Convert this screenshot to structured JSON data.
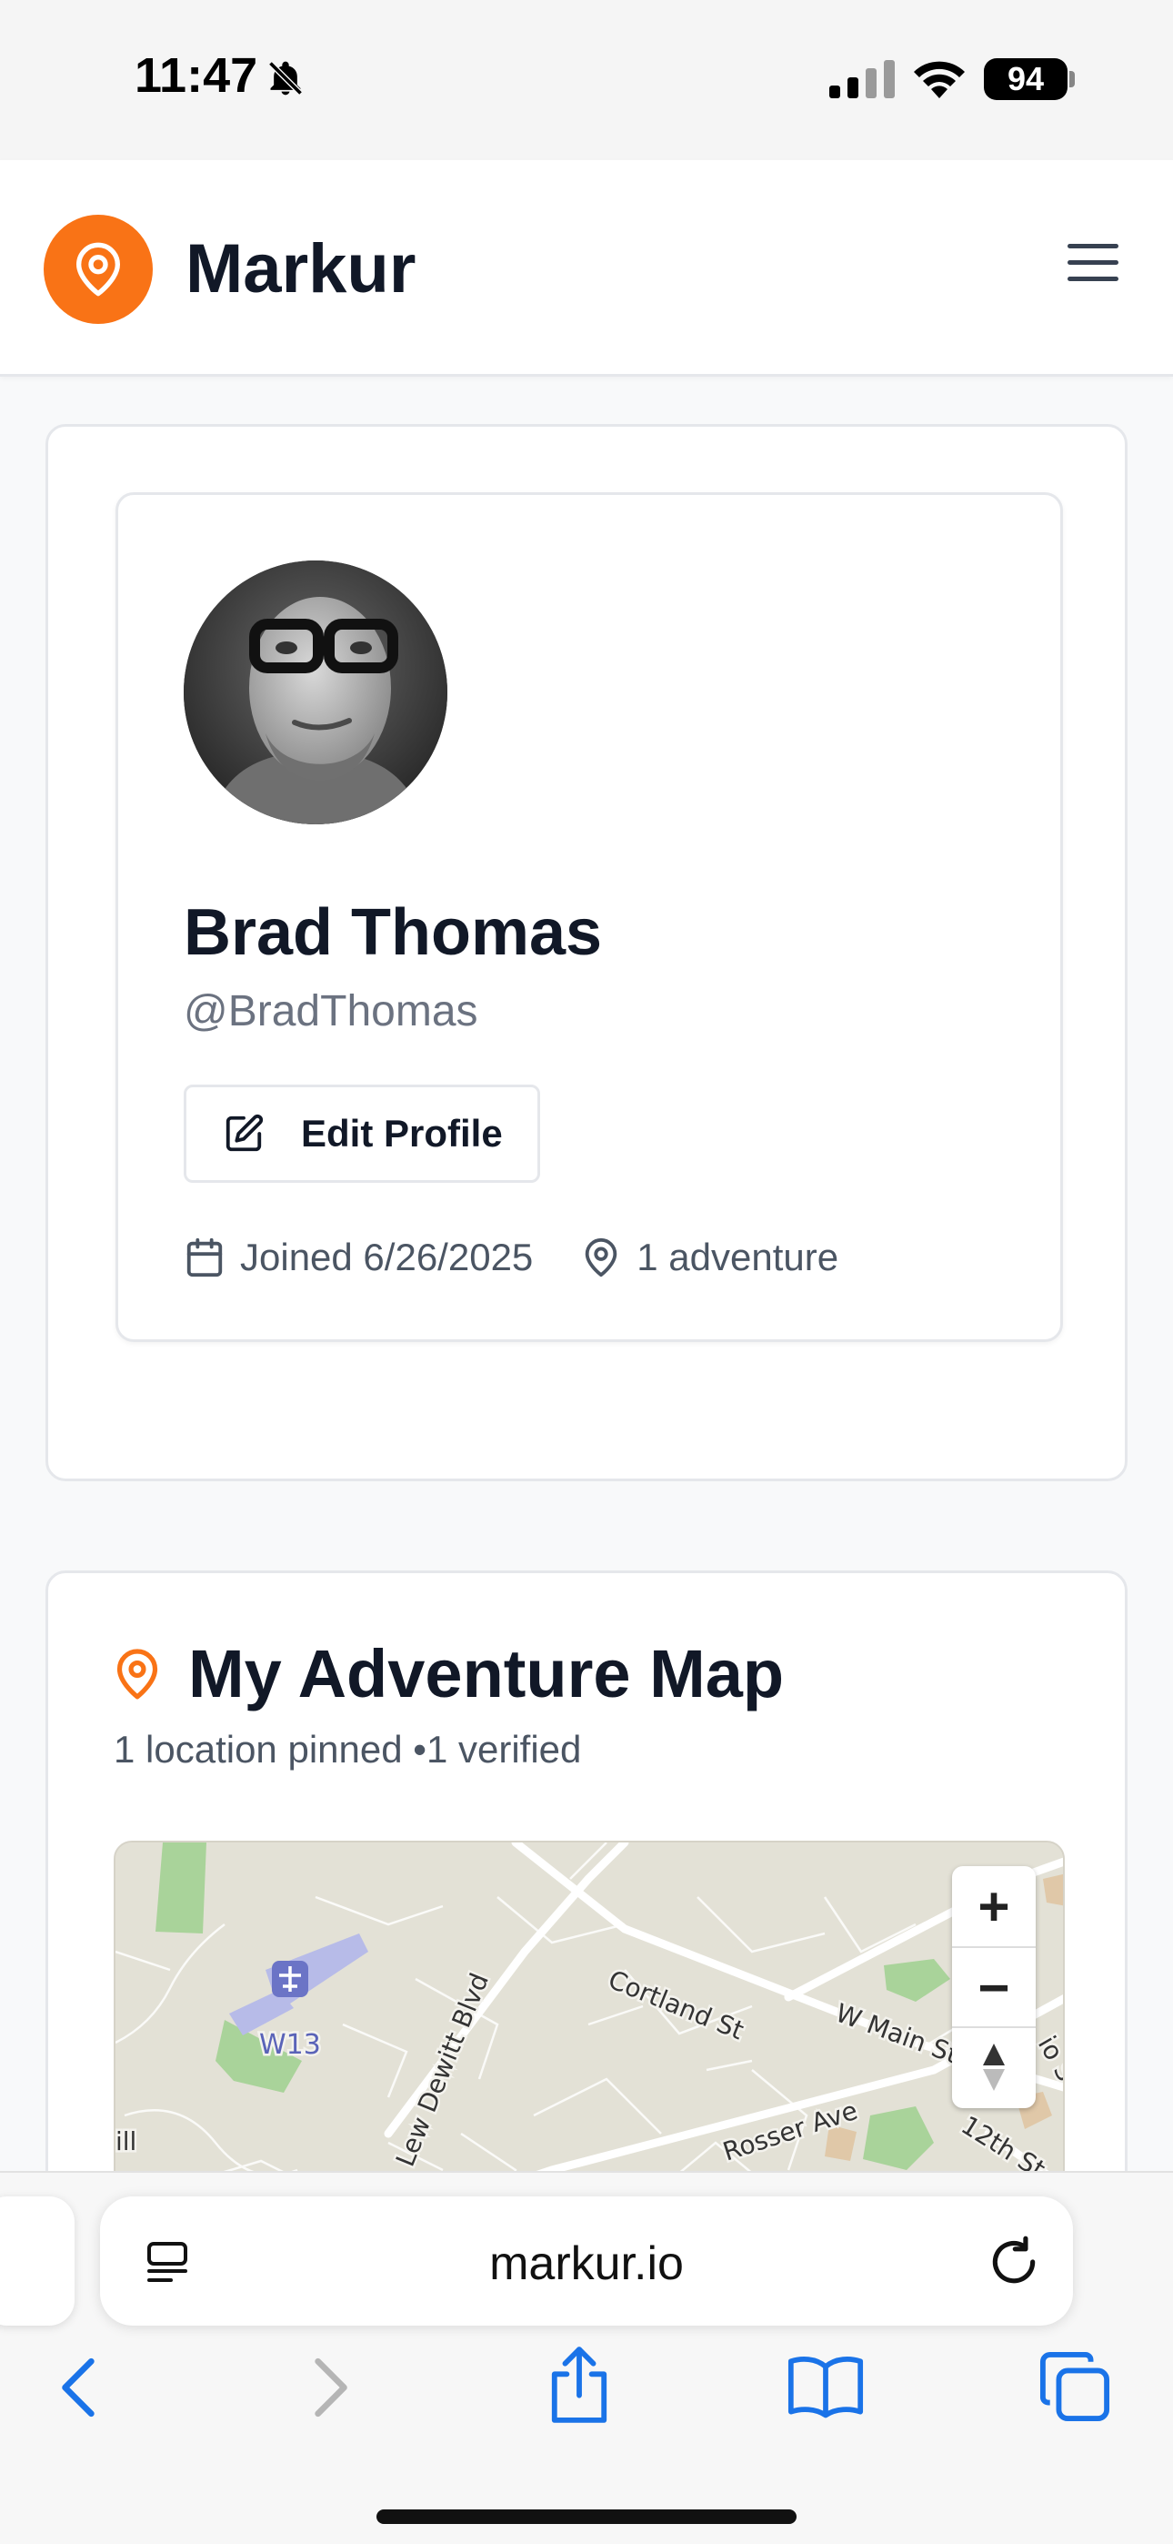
{
  "status_bar": {
    "time": "11:47",
    "battery": "94",
    "icons": [
      "bell-slash-icon",
      "cellular-signal-icon",
      "wifi-icon",
      "battery-icon"
    ]
  },
  "header": {
    "brand": "Markur",
    "brand_color": "#f97316",
    "icons": [
      "map-pin-icon",
      "hamburger-menu-icon"
    ]
  },
  "profile": {
    "name": "Brad Thomas",
    "handle": "@BradThomas",
    "edit_button_label": "Edit Profile",
    "joined": "Joined 6/26/2025",
    "adventures": "1 adventure"
  },
  "adventure_map": {
    "title": "My Adventure Map",
    "subtitle": "1 location pinned •1 verified",
    "map_labels": {
      "airport": "W13",
      "street_1": "Lew Dewitt Blvd",
      "street_2": "Cortland St",
      "street_3": "W Main St",
      "street_4": "Rosser Ave",
      "street_5": "12th St",
      "edge_1": "ill",
      "edge_2": "io S"
    },
    "zoom_in": "+",
    "zoom_out": "−"
  },
  "browser": {
    "url": "markur.io",
    "icons": [
      "page-menu-icon",
      "reload-icon",
      "back-icon",
      "forward-icon",
      "share-icon",
      "bookmarks-icon",
      "tabs-icon"
    ]
  }
}
